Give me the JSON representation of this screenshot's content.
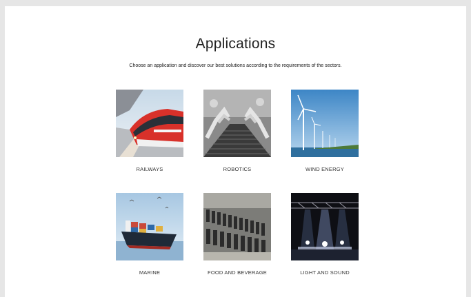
{
  "page": {
    "title": "Applications",
    "subtitle": "Choose an application and discover our best solutions according to the requirements of the sectors."
  },
  "applications": [
    {
      "label": "RAILWAYS",
      "image": "train-photo"
    },
    {
      "label": "ROBOTICS",
      "image": "robot-arms-photo"
    },
    {
      "label": "WIND ENERGY",
      "image": "wind-turbines-photo"
    },
    {
      "label": "MARINE",
      "image": "cargo-ship-photo"
    },
    {
      "label": "FOOD AND BEVERAGE",
      "image": "bottling-line-photo"
    },
    {
      "label": "LIGHT AND SOUND",
      "image": "stage-lights-photo"
    }
  ]
}
